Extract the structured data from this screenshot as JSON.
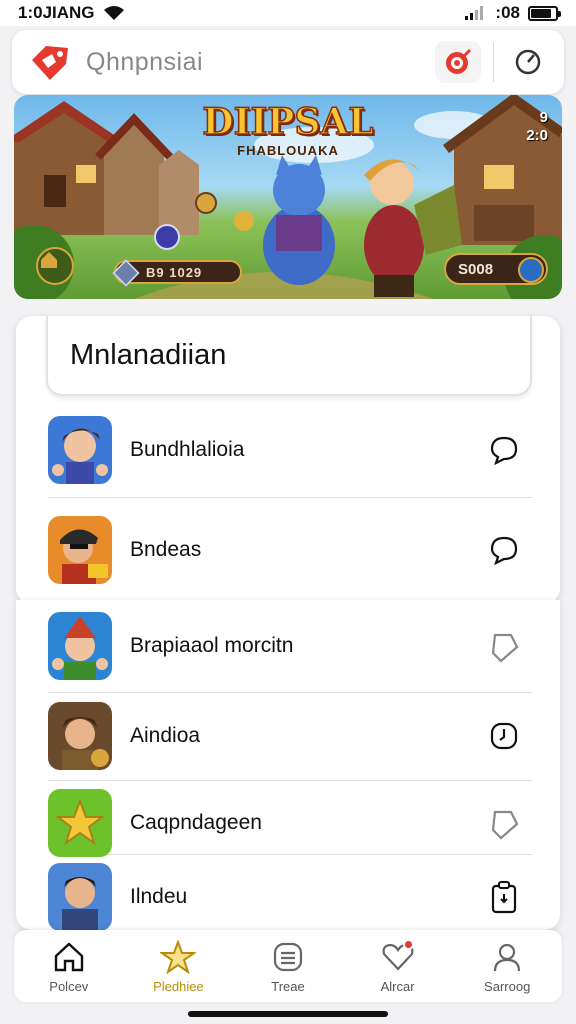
{
  "status_bar": {
    "time": "1:0JIANG",
    "right_text": ":08",
    "battery_level": 0.85
  },
  "header": {
    "title": "Qhnpnsiai",
    "logo_icon": "red-tag-logo-icon",
    "action_icon": "red-target-icon",
    "secondary_icon": "compass-icon"
  },
  "banner": {
    "title": "DIIPSAL",
    "subtitle": "FHABLOUAKA",
    "top_right": "9\n2:0",
    "left_counter": "B9 1029",
    "right_counter": "S008"
  },
  "section": {
    "title": "Mnlanadiian"
  },
  "list": [
    {
      "label": "Bundhlalioia",
      "icon": "hero-avatar-icon",
      "action_icon": "chat-bubble-icon"
    },
    {
      "label": "Bndeas",
      "icon": "pirate-avatar-icon",
      "action_icon": "chat-bubble-icon"
    },
    {
      "label": "Brapiaaol morcitn",
      "icon": "elf-avatar-icon",
      "action_icon": "tag-icon"
    },
    {
      "label": "Aindioa",
      "icon": "warrior-avatar-icon",
      "action_icon": "clock-icon"
    },
    {
      "label": "Caqpndageen",
      "icon": "star-icon",
      "action_icon": "tag-icon"
    },
    {
      "label": "Ilndeu",
      "icon": "man-avatar-icon",
      "action_icon": "clipboard-icon"
    }
  ],
  "bottom_nav": [
    {
      "label": "Polcev",
      "icon": "home-icon",
      "active": false
    },
    {
      "label": "Pledhiee",
      "icon": "star-icon",
      "active": true
    },
    {
      "label": "Treae",
      "icon": "list-icon",
      "active": false
    },
    {
      "label": "Alrcar",
      "icon": "heart-icon",
      "active": false
    },
    {
      "label": "Sarroog",
      "icon": "user-icon",
      "active": false
    }
  ],
  "colors": {
    "accent_gold": "#b88d06",
    "brand_red": "#e53a2f",
    "badge_red": "#e33b2e"
  }
}
